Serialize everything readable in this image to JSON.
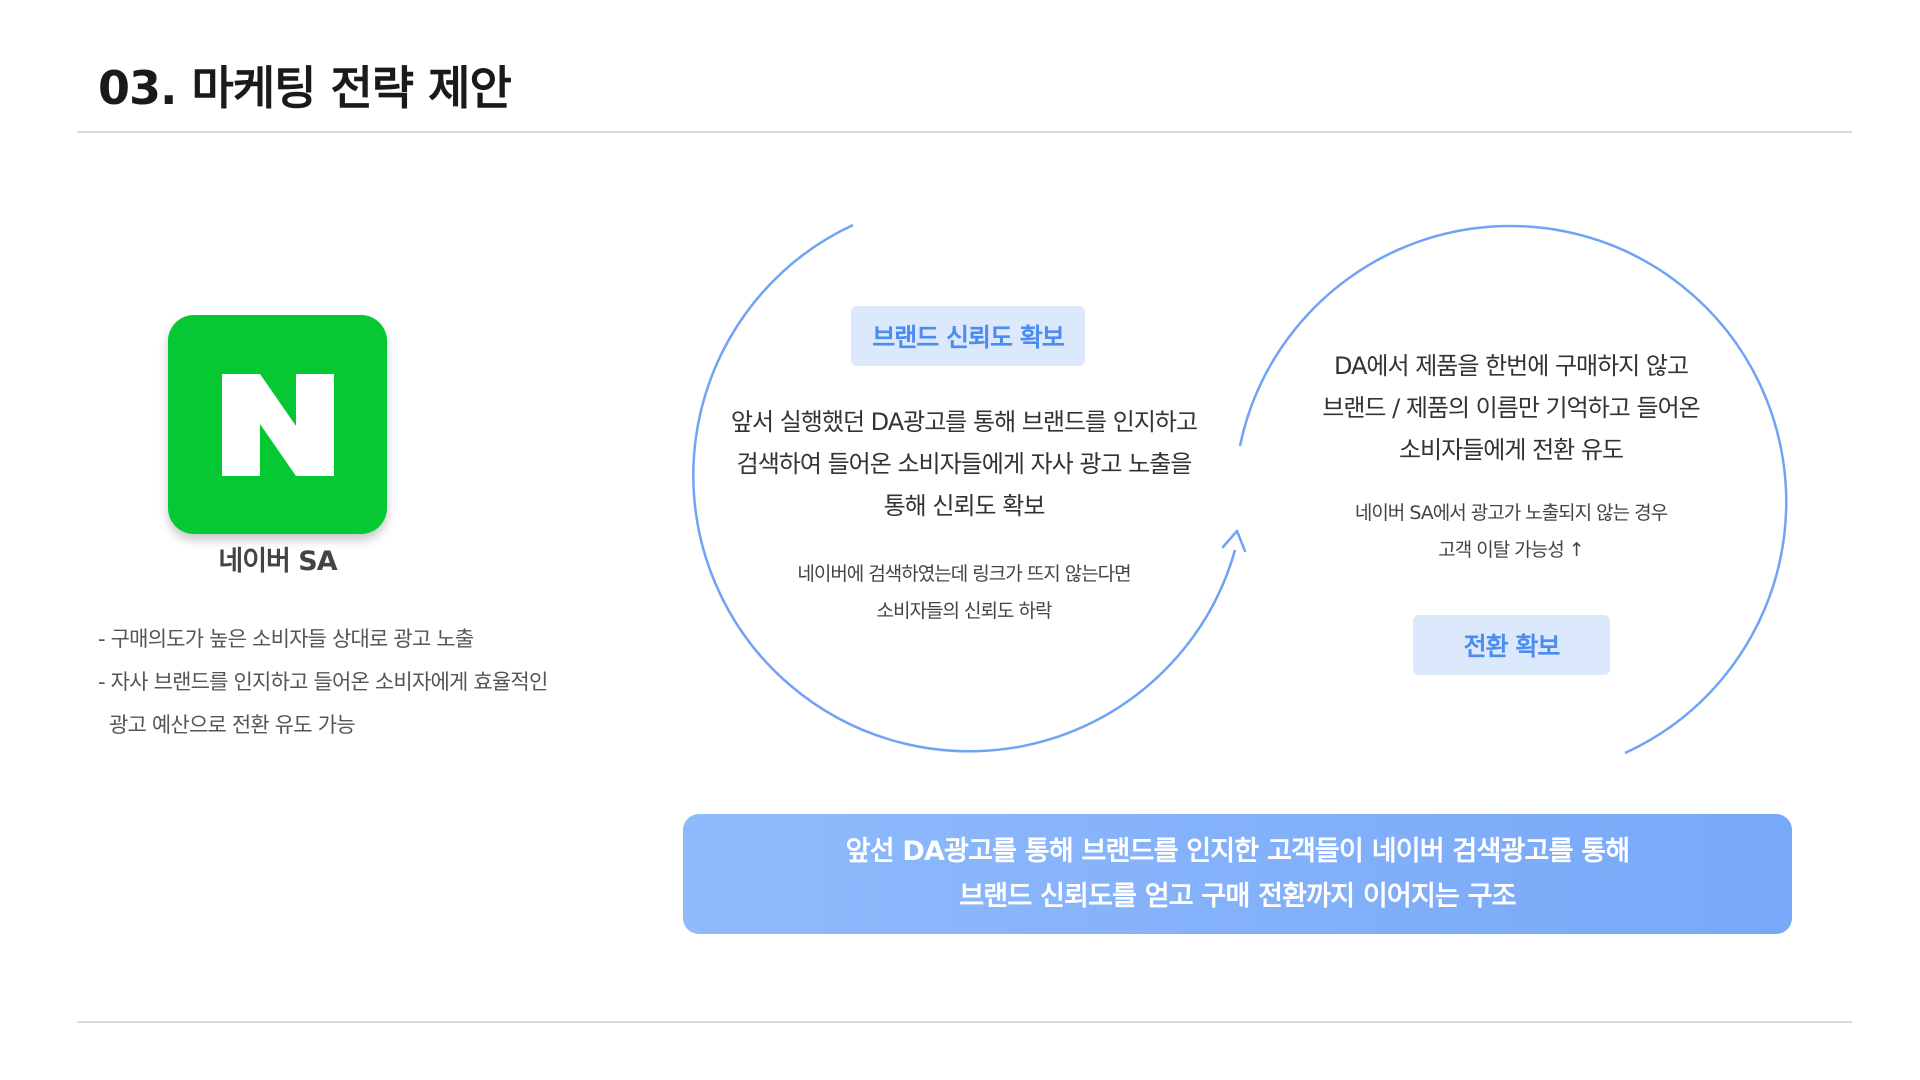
{
  "header": {
    "title": "03. 마케팅 전략 제안"
  },
  "left": {
    "logo_letter": "N",
    "logo_label": "네이버 SA",
    "bullets": [
      "- 구매의도가 높은 소비자들 상대로 광고 노출",
      "- 자사 브랜드를 인지하고 들어온 소비자에게 효율적인",
      "광고 예산으로 전환 유도 가능"
    ]
  },
  "cycle_left": {
    "tag": "브랜드 신뢰도 확보",
    "main": [
      "앞서 실행했던 DA광고를 통해 브랜드를 인지하고",
      "검색하여 들어온 소비자들에게 자사 광고 노출을",
      "통해 신뢰도 확보"
    ],
    "sub": [
      "네이버에 검색하였는데 링크가 뜨지 않는다면",
      "소비자들의 신뢰도 하락"
    ]
  },
  "cycle_right": {
    "main": [
      "DA에서 제품을 한번에 구매하지 않고",
      "브랜드 / 제품의 이름만 기억하고 들어온",
      "소비자들에게 전환 유도"
    ],
    "sub": [
      "네이버 SA에서 광고가 노출되지 않는 경우",
      "고객 이탈 가능성 ↑"
    ],
    "tag": "전환 확보"
  },
  "banner": {
    "lines": [
      "앞선 DA광고를 통해 브랜드를 인지한 고객들이 네이버 검색광고를 통해",
      "브랜드 신뢰도를 얻고 구매 전환까지 이어지는 구조"
    ]
  },
  "colors": {
    "naver_green": "#06c832",
    "accent_blue": "#4a8cf0",
    "arc_blue": "#6fa3f5",
    "pill_bg": "#dce9fc"
  }
}
